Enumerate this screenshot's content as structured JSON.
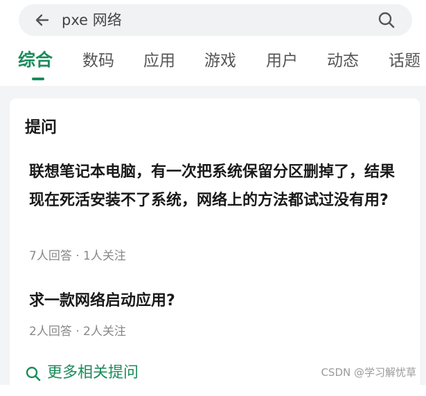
{
  "search": {
    "query": "pxe 网络"
  },
  "tabs": [
    {
      "label": "综合",
      "active": true
    },
    {
      "label": "数码",
      "active": false
    },
    {
      "label": "应用",
      "active": false
    },
    {
      "label": "游戏",
      "active": false
    },
    {
      "label": "用户",
      "active": false
    },
    {
      "label": "动态",
      "active": false
    },
    {
      "label": "话题",
      "active": false
    }
  ],
  "card": {
    "title": "提问",
    "questions": [
      {
        "text": "联想笔记本电脑，有一次把系统保留分区删掉了，结果现在死活安装不了系统，网络上的方法都试过没有用?",
        "meta": "7人回答 · 1人关注"
      },
      {
        "text": "求一款网络启动应用?",
        "meta": "2人回答 · 2人关注"
      }
    ],
    "more_label": "更多相关提问"
  },
  "watermark": "CSDN @学习解忧草",
  "colors": {
    "accent": "#1a8c59",
    "search_bg": "#f1f2f4",
    "page_bg": "#f3f4f6"
  },
  "icons": [
    "back-arrow-icon",
    "search-icon",
    "search-more-icon"
  ]
}
